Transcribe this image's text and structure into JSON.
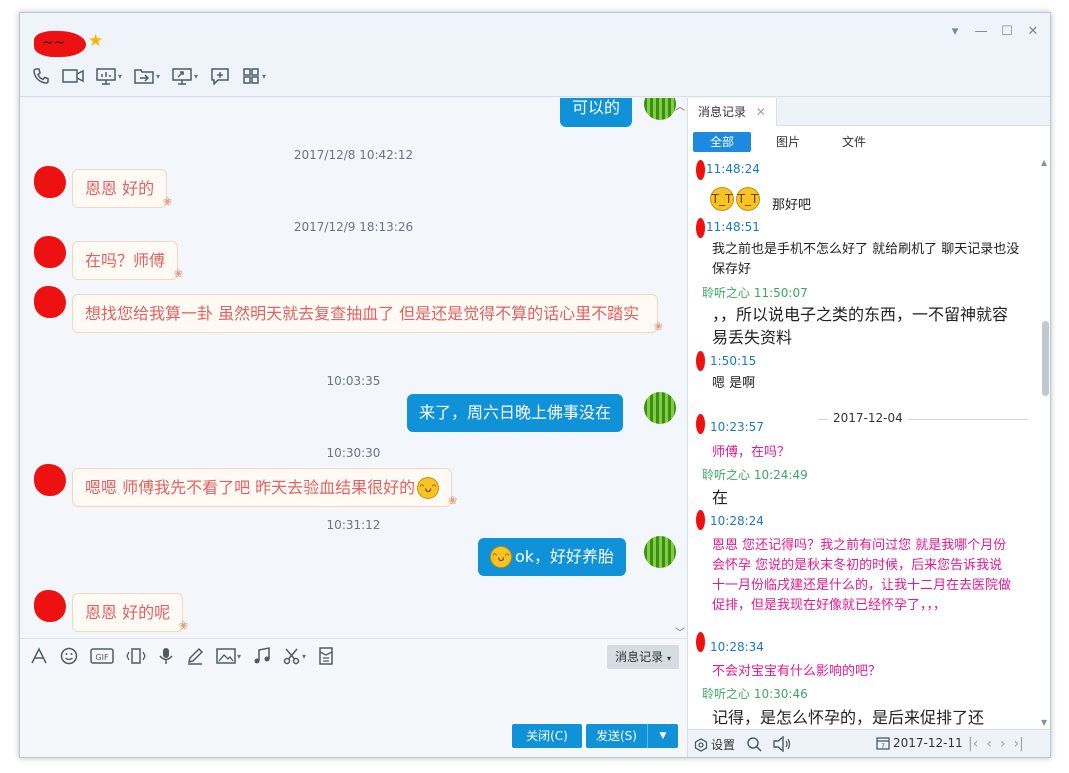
{
  "header": {
    "contact_name": "~~",
    "window_controls": [
      "▾",
      "—",
      "☐",
      "✕"
    ]
  },
  "chat": {
    "top_bubble": "可以的",
    "messages": [
      {
        "time": "2017/12/8 10:42:12",
        "dir": "in",
        "text": "恩恩  好的"
      },
      {
        "time": "2017/12/9 18:13:26",
        "dir": "in",
        "text": "在吗？师傅"
      },
      {
        "dir": "in",
        "text": "想找您给我算一卦  虽然明天就去复查抽血了 但是还是觉得不算的话心里不踏实"
      },
      {
        "time": "10:03:35",
        "dir": "out",
        "text": "来了，周六日晚上佛事没在"
      },
      {
        "time": "10:30:30",
        "dir": "in",
        "text": "嗯嗯  师傅我先不看了吧  昨天去验血结果很好的"
      },
      {
        "time": "10:31:12",
        "dir": "out",
        "text": "ok，好好养胎"
      },
      {
        "dir": "in",
        "text": "恩恩  好的呢"
      }
    ]
  },
  "input_area": {
    "history_button": "消息记录",
    "close_button": "关闭(C)",
    "send_button": "发送(S)"
  },
  "history": {
    "tab_label": "消息记录",
    "filters": [
      "全部",
      "图片",
      "文件"
    ],
    "entries": [
      {
        "time": "11:48:24"
      },
      {
        "text": "那好吧"
      },
      {
        "time": "11:48:51"
      },
      {
        "text": "我之前也是手机不怎么好了 就给刷机了  聊天记录也没保存好"
      },
      {
        "name_time": "聆听之心 11:50:07"
      },
      {
        "text": "，，所以说电子之类的东西，一不留神就容易丢失资料"
      },
      {
        "time": "1:50:15"
      },
      {
        "text": "嗯 是啊"
      },
      {
        "date": "2017-12-04"
      },
      {
        "time": "10:23:57"
      },
      {
        "text": "师傅，在吗？"
      },
      {
        "name_time": "聆听之心 10:24:49"
      },
      {
        "text": "在"
      },
      {
        "time": "10:28:24"
      },
      {
        "text": "恩恩  您还记得吗？我之前有问过您 就是我哪个月份会怀孕  您说的是秋末冬初的时候，后来您告诉我说 十一月份临戌建还是什么的，让我十二月在去医院做促排，但是我现在好像就已经怀孕了，，，"
      },
      {
        "time": "10:28:34"
      },
      {
        "text": "不会对宝宝有什么影响的吧？"
      },
      {
        "name_time": "聆听之心 10:30:46"
      },
      {
        "text": "记得，是怎么怀孕的，是后来促排了还"
      }
    ],
    "footer": {
      "settings": "设置",
      "date": "2017-12-11"
    }
  }
}
